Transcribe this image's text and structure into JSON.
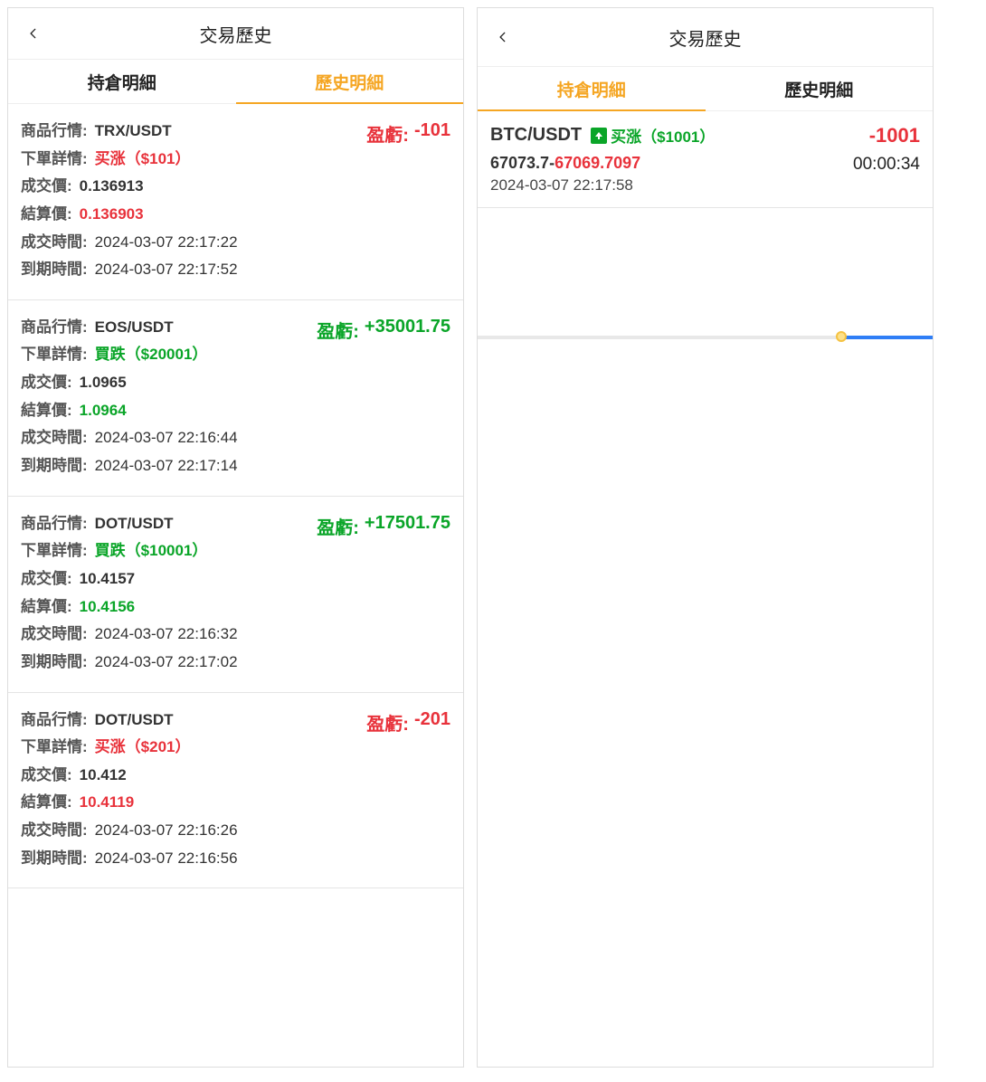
{
  "left": {
    "header_title": "交易歷史",
    "tabs": {
      "holding": "持倉明細",
      "history": "歷史明細",
      "active": "history"
    },
    "labels": {
      "product": "商品行情:",
      "order": "下單詳情:",
      "deal_price": "成交價:",
      "settle_price": "結算價:",
      "deal_time": "成交時間:",
      "expire_time": "到期時間:",
      "pnl": "盈虧:"
    },
    "records": [
      {
        "pair": "TRX/USDT",
        "order_text": "买涨（$101）",
        "order_dir": "up",
        "deal_price": "0.136913",
        "settle_price": "0.136903",
        "settle_dir": "down",
        "deal_time": "2024-03-07 22:17:22",
        "expire_time": "2024-03-07 22:17:52",
        "pnl_value": "-101",
        "pnl_dir": "down"
      },
      {
        "pair": "EOS/USDT",
        "order_text": "買跌（$20001）",
        "order_dir": "down_win",
        "deal_price": "1.0965",
        "settle_price": "1.0964",
        "settle_dir": "up",
        "deal_time": "2024-03-07 22:16:44",
        "expire_time": "2024-03-07 22:17:14",
        "pnl_value": "+35001.75",
        "pnl_dir": "up"
      },
      {
        "pair": "DOT/USDT",
        "order_text": "買跌（$10001）",
        "order_dir": "down_win",
        "deal_price": "10.4157",
        "settle_price": "10.4156",
        "settle_dir": "up",
        "deal_time": "2024-03-07 22:16:32",
        "expire_time": "2024-03-07 22:17:02",
        "pnl_value": "+17501.75",
        "pnl_dir": "up"
      },
      {
        "pair": "DOT/USDT",
        "order_text": "买涨（$201）",
        "order_dir": "up",
        "deal_price": "10.412",
        "settle_price": "10.4119",
        "settle_dir": "down",
        "deal_time": "2024-03-07 22:16:26",
        "expire_time": "2024-03-07 22:16:56",
        "pnl_value": "-201",
        "pnl_dir": "down"
      }
    ]
  },
  "right": {
    "header_title": "交易歷史",
    "tabs": {
      "holding": "持倉明細",
      "history": "歷史明細",
      "active": "holding"
    },
    "holding": {
      "pair": "BTC/USDT",
      "badge_text": "买涨（$1001）",
      "open_price": "67073.7",
      "sep": "-",
      "current_price": "67069.7097",
      "time": "2024-03-07 22:17:58",
      "amount": "-1001",
      "countdown": "00:00:34"
    }
  }
}
